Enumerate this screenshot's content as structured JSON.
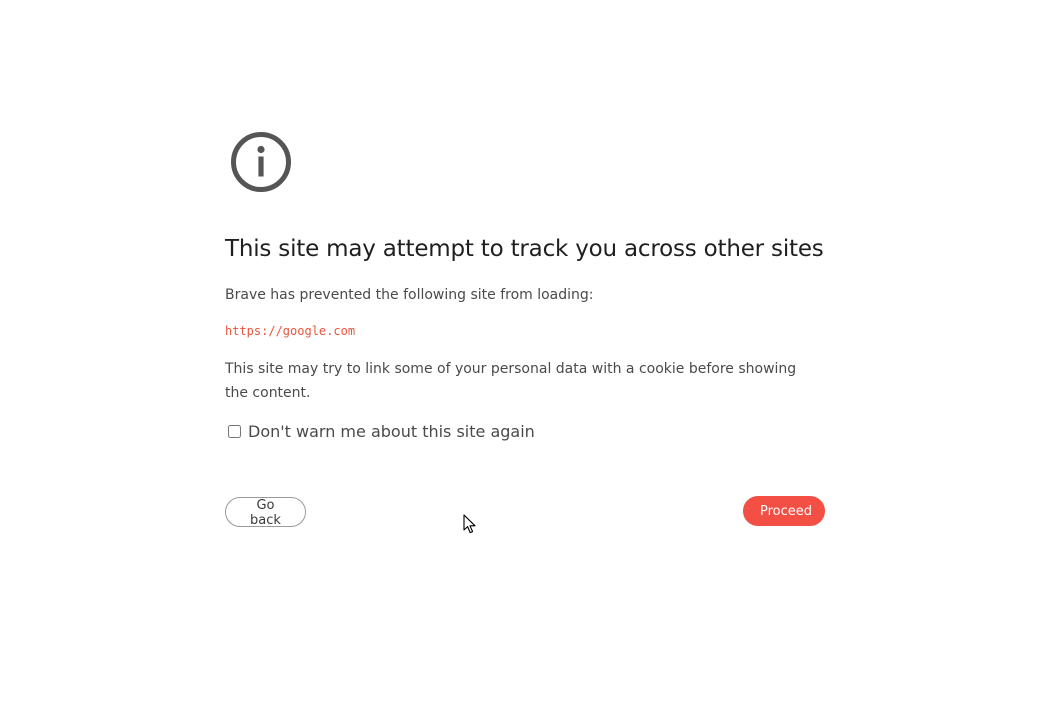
{
  "dialog": {
    "icon": "info-circle-icon",
    "title": "This site may attempt to track you across other sites",
    "prevented_text": "Brave has prevented the following site from loading:",
    "blocked_url": "https://google.com",
    "description": "This site may try to link some of your personal data with a cookie before showing the content.",
    "dont_warn_label": "Don't warn me about this site again",
    "dont_warn_checked": false
  },
  "actions": {
    "go_back_label": "Go back",
    "proceed_label": "Proceed"
  },
  "colors": {
    "accent": "#f34f45",
    "url": "#e8553e",
    "icon": "#555555"
  },
  "cursor": {
    "icon": "mouse-pointer-icon"
  }
}
